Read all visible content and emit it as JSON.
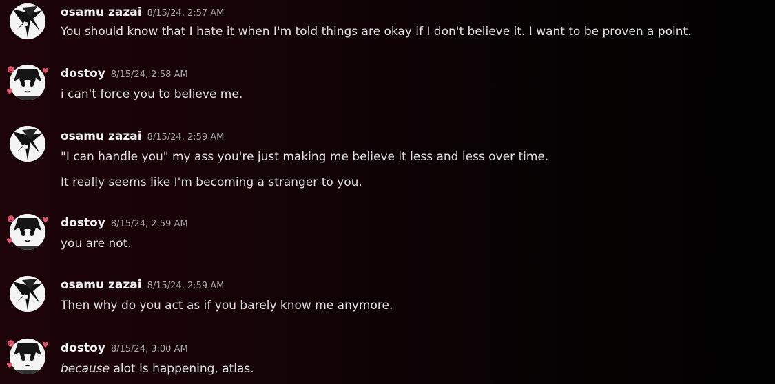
{
  "messages": [
    {
      "author": "osamu zazai",
      "timestamp": "8/15/24, 2:57 AM",
      "avatar_icon": "osamu-avatar-icon",
      "lines": [
        "You should know that I hate it when I'm told things are okay if I don't believe it. I want to be proven a point."
      ]
    },
    {
      "author": "dostoy",
      "timestamp": "8/15/24, 2:58 AM",
      "avatar_icon": "dostoy-avatar-icon",
      "lines": [
        "i can't force you to believe me."
      ]
    },
    {
      "author": "osamu zazai",
      "timestamp": "8/15/24, 2:59 AM",
      "avatar_icon": "osamu-avatar-icon",
      "lines": [
        "\"I can handle you\" my ass you're just making me believe it less and less over time.",
        "It really seems like I'm becoming a stranger to you."
      ]
    },
    {
      "author": "dostoy",
      "timestamp": "8/15/24, 2:59 AM",
      "avatar_icon": "dostoy-avatar-icon",
      "lines": [
        "you are not."
      ]
    },
    {
      "author": "osamu zazai",
      "timestamp": "8/15/24, 2:59 AM",
      "avatar_icon": "osamu-avatar-icon",
      "lines": [
        "Then why do you act as if you barely know me anymore."
      ]
    },
    {
      "author": "dostoy",
      "timestamp": "8/15/24, 3:00 AM",
      "avatar_icon": "dostoy-avatar-icon",
      "line_italic": "because",
      "line_rest": " alot is happening, atlas."
    }
  ],
  "colors": {
    "background_left": "#1d0409",
    "background_right": "#010101",
    "username": "#f2f3f5",
    "timestamp": "#a9a9ac",
    "message_text": "#e0e0e3",
    "heart_accent": "#e8576f"
  }
}
